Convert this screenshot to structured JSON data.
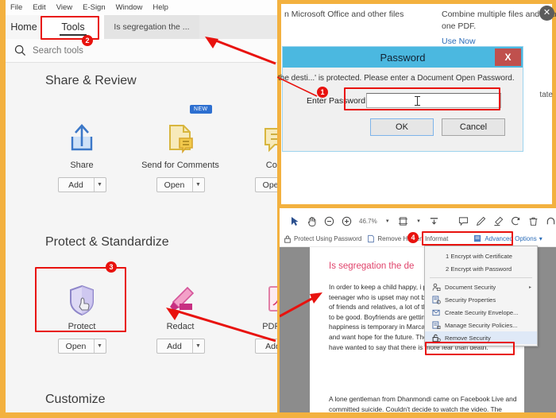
{
  "app": {
    "menubar": [
      "File",
      "Edit",
      "View",
      "E-Sign",
      "Window",
      "Help"
    ],
    "tabs": [
      {
        "label": "Home",
        "active": false
      },
      {
        "label": "Tools",
        "active": true
      },
      {
        "label": "Is segregation the ...",
        "active": false
      }
    ],
    "search": {
      "placeholder": "Search tools",
      "value": "",
      "icon": "search-icon"
    }
  },
  "tools": {
    "sections": [
      {
        "title": "Share & Review"
      },
      {
        "title": "Protect & Standardize"
      },
      {
        "title": "Customize"
      }
    ],
    "share_review": [
      {
        "label": "Share",
        "button": "Add",
        "icon": "share-upload-icon",
        "badge": ""
      },
      {
        "label": "Send for Comments",
        "button": "Open",
        "icon": "send-comments-icon",
        "badge": "NEW"
      },
      {
        "label": "Comm",
        "button": "Open",
        "icon": "comment-bubble-icon",
        "badge": ""
      }
    ],
    "protect_standardize": [
      {
        "label": "Protect",
        "button": "Open",
        "icon": "shield-icon",
        "badge": ""
      },
      {
        "label": "Redact",
        "button": "Add",
        "icon": "marker-pen-icon",
        "badge": ""
      },
      {
        "label": "PDF Sta",
        "button": "Add",
        "icon": "pdf-standards-icon",
        "badge": ""
      }
    ]
  },
  "promo": {
    "left_text": "n Microsoft Office and other files",
    "right_text_line1": "Combine multiple files and arrang",
    "right_text_line2": "one PDF.",
    "use_now": "Use Now",
    "close_icon": "close-icon",
    "edge_text": "tate"
  },
  "password_dialog": {
    "title": "Password",
    "close_label": "X",
    "message": "the desti...' is protected. Please enter a Document Open Password.",
    "field_label": "Enter Password:",
    "field_value": "",
    "ok": "OK",
    "cancel": "Cancel"
  },
  "viewer": {
    "toolbar_icons": [
      "cursor-select-icon",
      "hand-pan-icon",
      "zoom-out-icon",
      "zoom-in-icon"
    ],
    "zoom_level": "46.7%",
    "toolbar_icons_2": [
      "fit-page-icon",
      "fit-width-icon"
    ],
    "toolbar_icons_3": [
      "comment-icon",
      "pen-icon",
      "highlight-icon",
      "stamp-icon",
      "delete-icon",
      "rotate-icon"
    ],
    "security_toolbar": [
      {
        "label": "Protect Using Password",
        "icon": "lock-password-icon"
      },
      {
        "label": "Remove Hidden Informat",
        "icon": "remove-hidden-icon"
      },
      {
        "label": "Advanced Options",
        "icon": "advanced-options-icon",
        "caret": "▾"
      }
    ]
  },
  "security_menu": {
    "items": [
      {
        "label": "1 Encrypt with Certificate",
        "icon": "",
        "indent": true,
        "submenu": false,
        "highlight": false
      },
      {
        "label": "2 Encrypt with Password",
        "icon": "",
        "indent": true,
        "submenu": false,
        "highlight": false
      },
      {
        "label": "Document Security",
        "icon": "user-lock-icon",
        "indent": false,
        "submenu": true,
        "highlight": false
      },
      {
        "label": "Security Properties",
        "icon": "properties-icon",
        "indent": false,
        "submenu": false,
        "highlight": false
      },
      {
        "label": "Create Security Envelope...",
        "icon": "envelope-icon",
        "indent": false,
        "submenu": false,
        "highlight": false
      },
      {
        "label": "Manage Security Policies...",
        "icon": "policies-icon",
        "indent": false,
        "submenu": false,
        "highlight": false
      },
      {
        "label": "Remove Security",
        "icon": "unlock-icon",
        "indent": false,
        "submenu": false,
        "highlight": true
      }
    ]
  },
  "document": {
    "heading": "Is segregation the de",
    "paragraph1": "In order to keep a child happy, i parents, family, animals, grass, teenager who is upset may not be able to say that he wants a lot of friends and relatives, a lot of thrills and a lot of love if he wants to be good. Boyfriends are getting along with girlfriends, but happiness is temporary in Marca's life. People want more people, and want hope for the future. The man who committed suicide may have wanted to say that there is more fear than death.",
    "paragraph2": "A lone gentleman from Dhanmondi came on Facebook Live and committed suicide. Couldn't decide to watch the video. The"
  },
  "markers": [
    {
      "n": "1",
      "target": "password-field"
    },
    {
      "n": "2",
      "target": "tools-tab"
    },
    {
      "n": "3",
      "target": "protect-tool"
    },
    {
      "n": "4",
      "target": "advanced-options"
    }
  ],
  "colors": {
    "frame": "#f3b13f",
    "highlight": "#e8120e",
    "dialog_title": "#4bb8e0",
    "dialog_close": "#c0504d",
    "heading": "#e0436b",
    "link": "#2b6cb8",
    "badge": "#2d6fd0"
  }
}
